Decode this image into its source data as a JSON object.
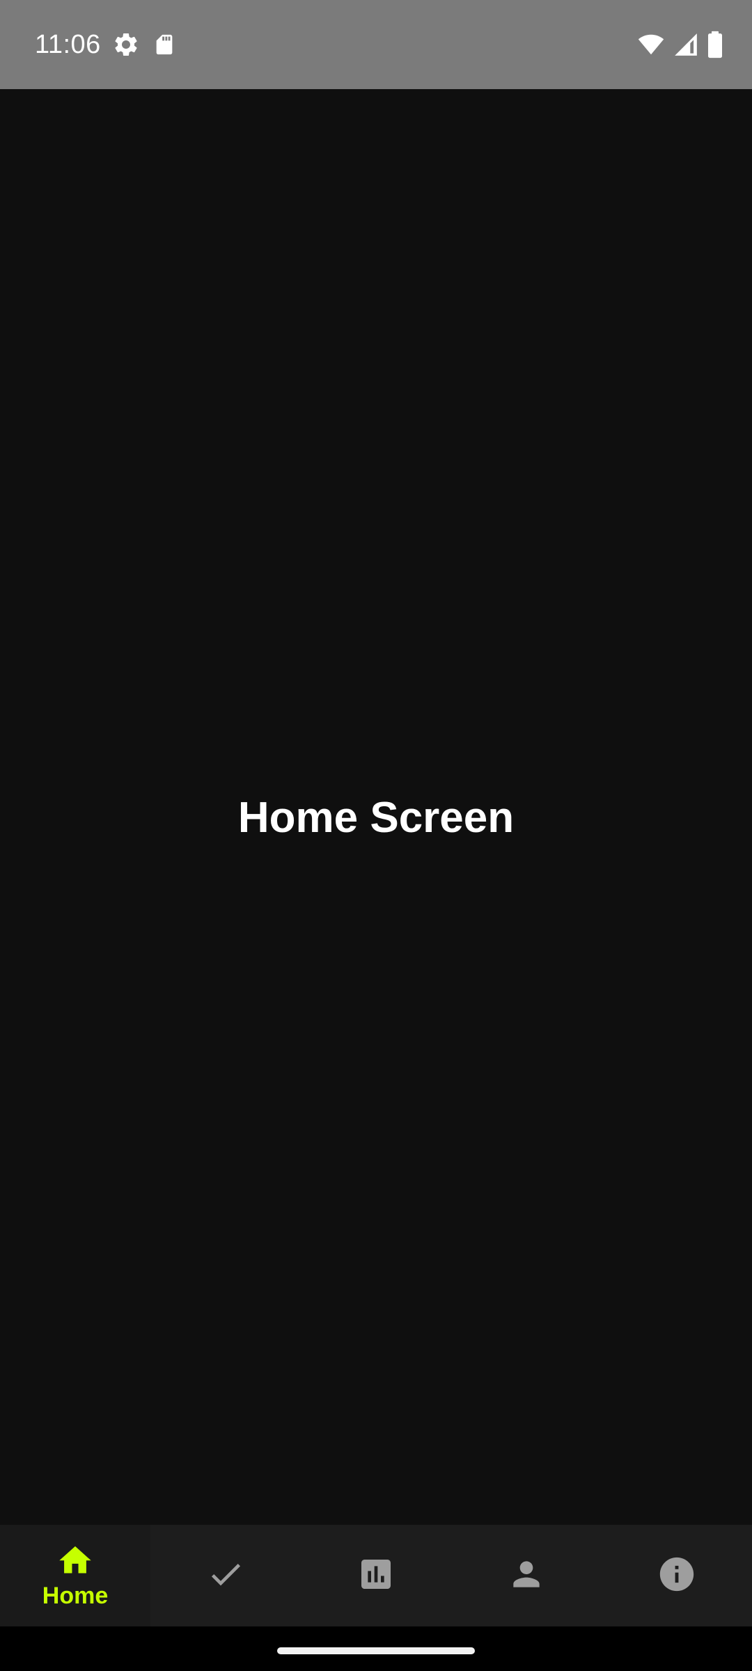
{
  "status_bar": {
    "time": "11:06",
    "left_icons": [
      "settings-gear-icon",
      "sd-card-icon"
    ],
    "right_icons": [
      "wifi-icon",
      "cell-signal-icon",
      "battery-icon"
    ],
    "background": "#7b7b7b"
  },
  "main": {
    "title": "Home Screen",
    "background": "#0f0f0f"
  },
  "bottom_nav": {
    "active_color": "#c6ff00",
    "inactive_color": "#9e9e9e",
    "items": [
      {
        "icon": "home-icon",
        "label": "Home",
        "active": true
      },
      {
        "icon": "check-icon",
        "label": "",
        "active": false
      },
      {
        "icon": "bar-chart-icon",
        "label": "",
        "active": false
      },
      {
        "icon": "person-icon",
        "label": "",
        "active": false
      },
      {
        "icon": "info-icon",
        "label": "",
        "active": false
      }
    ]
  }
}
